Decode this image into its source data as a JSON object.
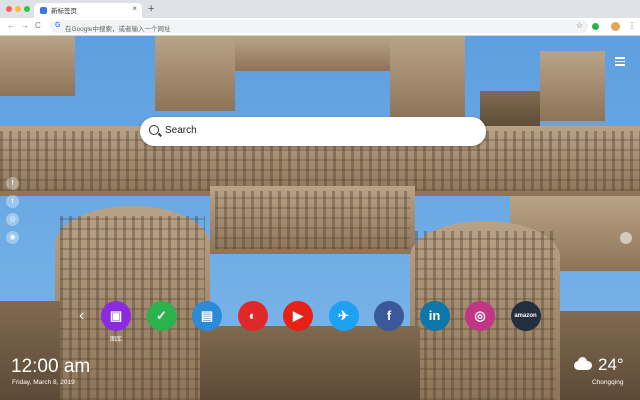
{
  "browser": {
    "tab_title": "新标签页",
    "tab_close": "×",
    "new_tab": "+",
    "omnibox_placeholder": "在Google中搜索，或者输入一个网址",
    "nav": {
      "back": "←",
      "forward": "→",
      "reload": "C"
    },
    "star": "☆",
    "menu": "⋮"
  },
  "search": {
    "placeholder": "Search"
  },
  "social_sidebar": [
    "facebook-icon",
    "twitter-icon",
    "snapchat-icon",
    "camera-icon"
  ],
  "apps": [
    {
      "name": "gallery",
      "label": "图库",
      "color": "#8a2be2",
      "icon": "image-icon"
    },
    {
      "name": "tasks",
      "label": "",
      "color": "#2bb24c",
      "icon": "check-icon"
    },
    {
      "name": "notes",
      "label": "",
      "color": "#2c8ad8",
      "icon": "notepad-icon"
    },
    {
      "name": "paint",
      "label": "",
      "color": "#e02828",
      "icon": "palette-icon"
    },
    {
      "name": "youtube",
      "label": "",
      "color": "#e62117",
      "icon": "play-icon"
    },
    {
      "name": "twitter",
      "label": "",
      "color": "#1da1f2",
      "icon": "bird-icon"
    },
    {
      "name": "facebook",
      "label": "",
      "color": "#3b5998",
      "icon": "f-icon"
    },
    {
      "name": "linkedin",
      "label": "",
      "color": "#0e76a8",
      "icon": "in-icon"
    },
    {
      "name": "instagram",
      "label": "",
      "color": "#c13584",
      "icon": "camera-icon"
    },
    {
      "name": "amazon",
      "label": "",
      "color": "#232f3e",
      "icon": "amazon-wordmark",
      "text": "amazon"
    }
  ],
  "clock": {
    "time": "12:00 am",
    "date": "Friday, March 8, 2019"
  },
  "weather": {
    "temp": "24°",
    "city": "Chongqing"
  },
  "colors": {
    "tab_strip": "#dee1e6",
    "sky": "#6aaae5",
    "stone": "#a38c70"
  }
}
